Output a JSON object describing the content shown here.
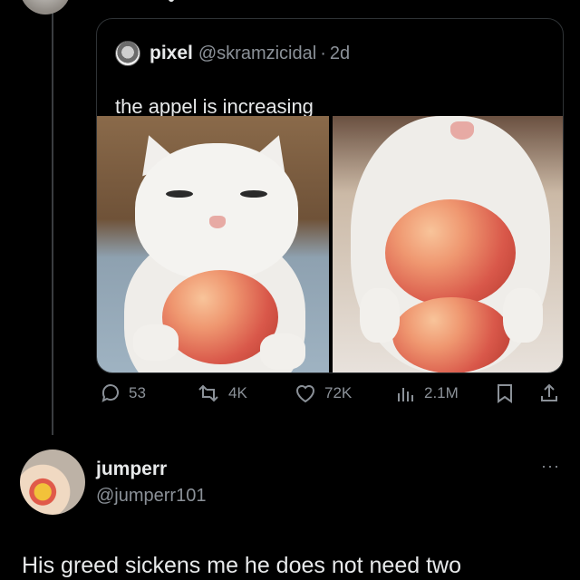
{
  "quoted_tweet": {
    "display_name": "pixel",
    "handle": "@skramzicidal",
    "separator": "·",
    "time": "2d",
    "text": "the appel is increasing"
  },
  "stats": {
    "replies": "53",
    "reposts": "4K",
    "likes": "72K",
    "views": "2.1M"
  },
  "reply": {
    "display_name": "jumperr",
    "handle": "@jumperr101",
    "more": "···",
    "text": "His greed sickens me he does not need two"
  },
  "colors": {
    "background": "#000000",
    "text_primary": "#e7e9ea",
    "text_secondary": "#8b9198",
    "border": "#2f3336"
  },
  "icons": [
    "reply-icon",
    "repost-icon",
    "like-icon",
    "views-icon",
    "bookmark-icon",
    "share-icon"
  ]
}
